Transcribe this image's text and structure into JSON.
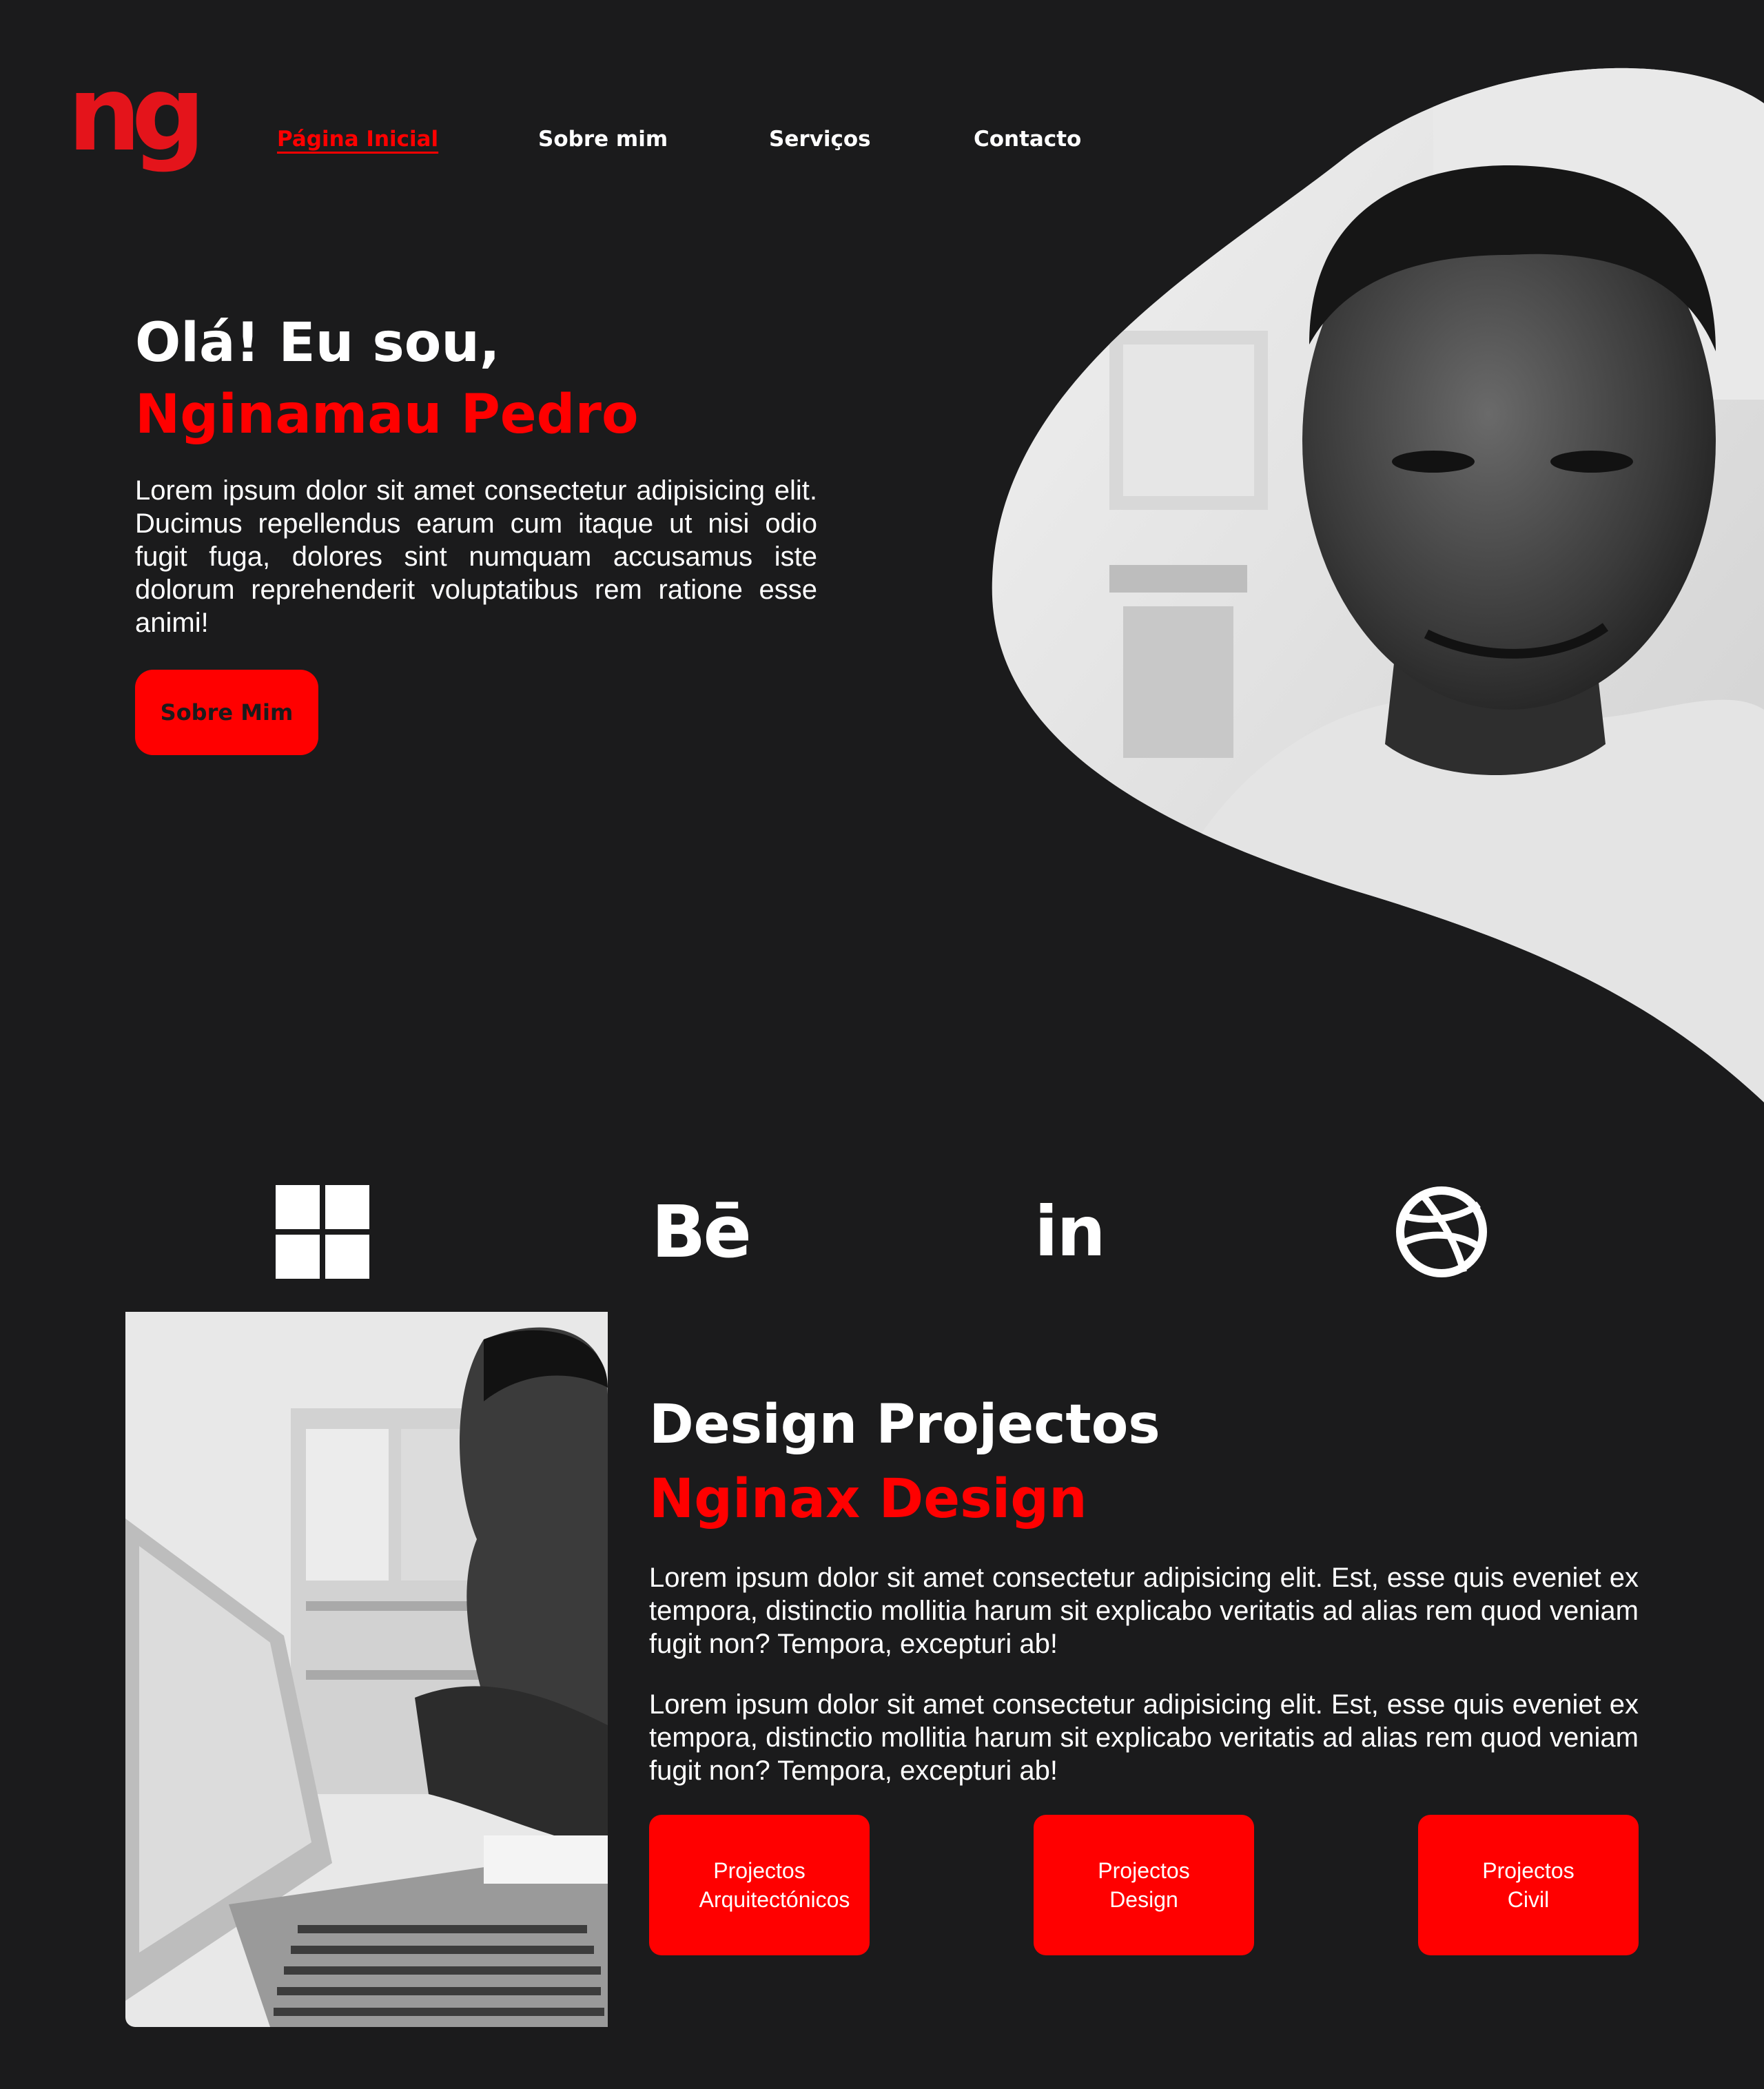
{
  "header": {
    "logo_text": "ng",
    "nav": [
      {
        "label": "Página Inicial",
        "active": true
      },
      {
        "label": "Sobre mim",
        "active": false
      },
      {
        "label": "Serviços",
        "active": false
      },
      {
        "label": "Contacto",
        "active": false
      }
    ]
  },
  "hero": {
    "greeting": "Olá! Eu sou,",
    "name": "Nginamau Pedro",
    "text": "Lorem ipsum dolor sit amet consectetur adipisicing elit. Ducimus repellendus earum cum itaque ut nisi odio fugit fuga, dolores sint numquam accusamus iste dolorum reprehenderit voluptatibus rem ratione esse animi!",
    "button": "Sobre Mim"
  },
  "social": {
    "windows": "windows-icon",
    "behance": "Bē",
    "linkedin": "in",
    "dribbble": "dribbble-icon"
  },
  "projects": {
    "title": "Design Projectos",
    "subtitle": "Nginax Design",
    "paragraphs": [
      "Lorem ipsum dolor sit amet consectetur adipisicing elit. Est, esse quis eveniet ex tempora, distinctio mollitia harum sit explicabo veritatis ad alias rem quod veniam fugit non? Tempora, excepturi ab!",
      "Lorem ipsum dolor sit amet consectetur adipisicing elit. Est, esse quis eveniet ex tempora, distinctio mollitia harum sit explicabo veritatis ad alias rem quod veniam fugit non? Tempora, excepturi ab!"
    ],
    "buttons": [
      {
        "line1": "Projectos",
        "line2": "Arquitectónicos"
      },
      {
        "line1": "Projectos",
        "line2": "Design"
      },
      {
        "line1": "Projectos",
        "line2": "Civil"
      }
    ]
  },
  "colors": {
    "background": "#1b1b1c",
    "accent": "#ff0000",
    "text": "#ffffff"
  }
}
